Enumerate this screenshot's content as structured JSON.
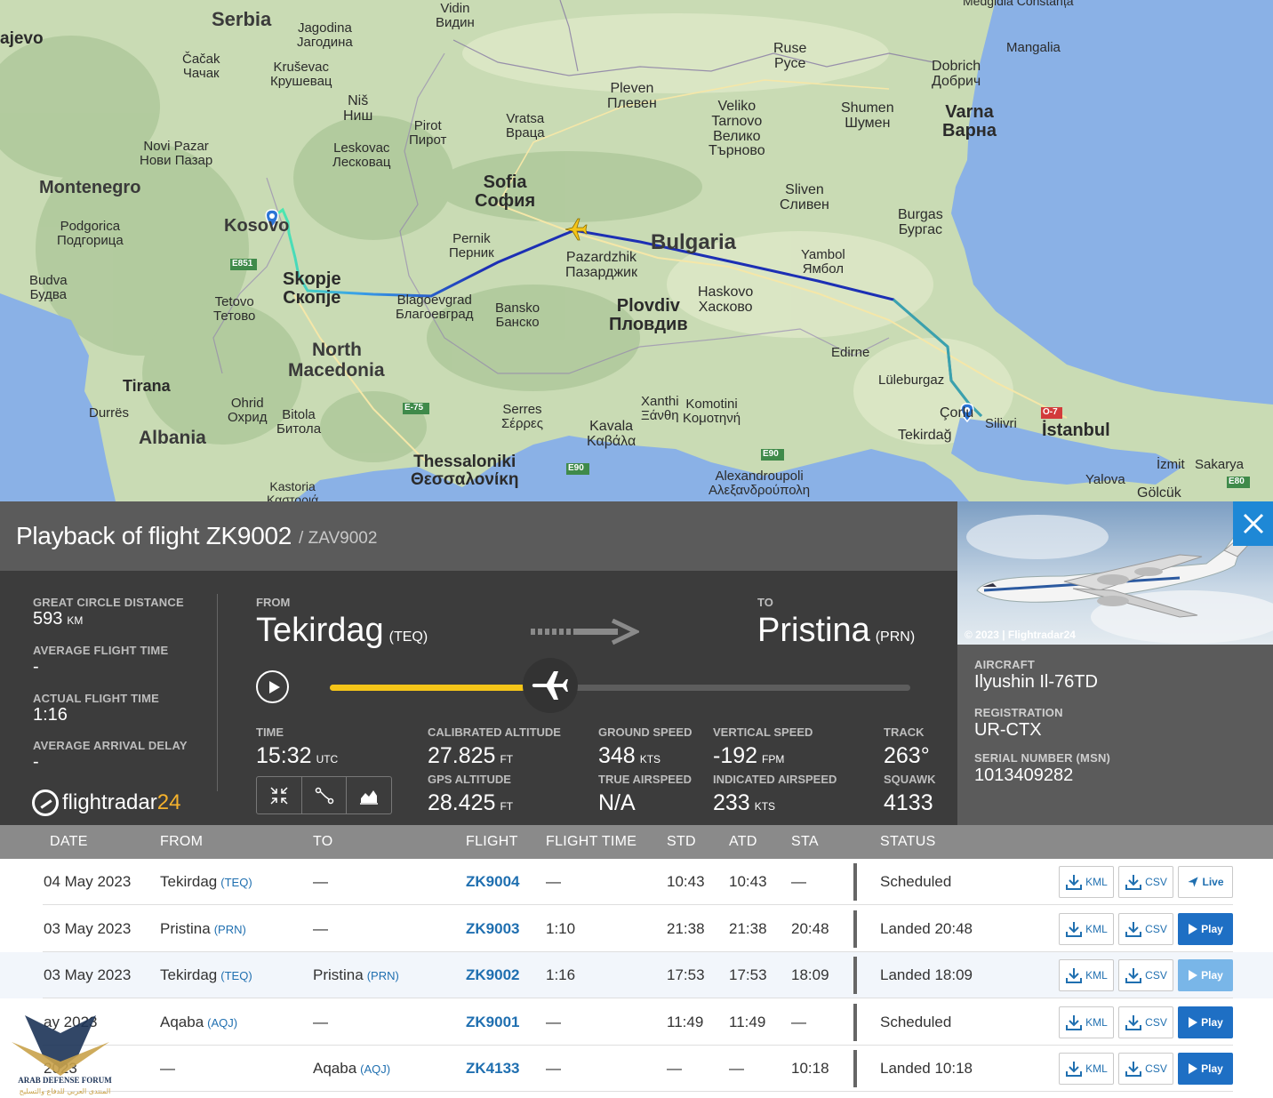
{
  "map": {
    "countries": {
      "serbia": "Serbia",
      "kosovo": "Kosovo",
      "montenegro": "Montenegro",
      "north_macedonia_1": "North",
      "north_macedonia_2": "Macedonia",
      "albania": "Albania",
      "bulgaria": "Bulgaria"
    },
    "cities": {
      "sarajevo": "ajevo",
      "vidin": [
        "Vidin",
        "Видин"
      ],
      "jagodina": [
        "Jagodina",
        "Јагодина"
      ],
      "cacak": [
        "Čačak",
        "Чачак"
      ],
      "krusevac": [
        "Kruševac",
        "Крушевац"
      ],
      "nis": [
        "Niš",
        "Ниш"
      ],
      "ruse": [
        "Ruse",
        "Русе"
      ],
      "dobrich": [
        "Dobrich",
        "Добрич"
      ],
      "mangalia": "Mangalia",
      "pleven": [
        "Pleven",
        "Плевен"
      ],
      "veliko": [
        "Veliko",
        "Tarnovo",
        "Велико",
        "Търново"
      ],
      "shumen": [
        "Shumen",
        "Шумен"
      ],
      "varna": [
        "Varna",
        "Варна"
      ],
      "pirot": [
        "Pirot",
        "Пирот"
      ],
      "vratsa": [
        "Vratsa",
        "Враца"
      ],
      "novi_pazar": [
        "Novi Pazar",
        "Нови Пазар"
      ],
      "leskovac": [
        "Leskovac",
        "Лесковац"
      ],
      "sofia": [
        "Sofia",
        "София"
      ],
      "sliven": [
        "Sliven",
        "Сливен"
      ],
      "burgas": [
        "Burgas",
        "Бургас"
      ],
      "podgorica": [
        "Podgorica",
        "Подгорица"
      ],
      "pernik": [
        "Pernik",
        "Перник"
      ],
      "pazardzhik": [
        "Pazardzhik",
        "Пазарджик"
      ],
      "yambol": [
        "Yambol",
        "Ямбол"
      ],
      "budva": [
        "Budva",
        "Будва"
      ],
      "skopje": [
        "Skopje",
        "Скопје"
      ],
      "tetovo": [
        "Tetovo",
        "Тетово"
      ],
      "blagoevgrad": [
        "Blagoevgrad",
        "Благоевград"
      ],
      "bansko": [
        "Bansko",
        "Банско"
      ],
      "haskovo": [
        "Haskovo",
        "Хасково"
      ],
      "plovdiv": [
        "Plovdiv",
        "Пловдив"
      ],
      "edirne": "Edirne",
      "luleburgaz": "Lüleburgaz",
      "tirana": "Tirana",
      "durres": "Durrës",
      "ohrid": [
        "Ohrid",
        "Охрид"
      ],
      "bitola": [
        "Bitola",
        "Битола"
      ],
      "xanthi": [
        "Xanthi",
        "Ξάνθη"
      ],
      "komotini": [
        "Komotini",
        "Κομοτηνή"
      ],
      "serres": [
        "Serres",
        "Σέρρες"
      ],
      "kavala": [
        "Kavala",
        "Καβάλα"
      ],
      "corlu": "Çorlu",
      "silivri": "Silivri",
      "istanbul": "İstanbul",
      "tekirdag": "Tekirdağ",
      "thessaloniki": [
        "Thessaloniki",
        "Θεσσαλονίκη"
      ],
      "alexandroupoli": [
        "Alexandroupoli",
        "Αλεξανδρούπολη"
      ],
      "izmit": "İzmit",
      "sakarya": "Sakarya",
      "yalova": "Yalova",
      "golcuk": "Gölcük",
      "kastoria": [
        "Kastoria",
        "Καστοριά"
      ],
      "top_right": "Medgidia Constanța"
    },
    "roads": {
      "e851": "E851",
      "e75": "E-75",
      "e90a": "E90",
      "e90b": "E90",
      "o7": "O-7",
      "e80": "E80"
    },
    "colors": {
      "sea": "#8ab1e6",
      "land": "#c9dbb4",
      "route": "#1c2fb4",
      "route_start": "#4ef0a8"
    }
  },
  "title": {
    "main": "Playback of flight ZK9002",
    "callsign": "/ ZAV9002"
  },
  "stats": {
    "great_circle_label": "GREAT CIRCLE DISTANCE",
    "great_circle_value": "593",
    "great_circle_unit": "KM",
    "avg_flight_label": "AVERAGE FLIGHT TIME",
    "avg_flight_value": "-",
    "actual_flight_label": "ACTUAL FLIGHT TIME",
    "actual_flight_value": "1:16",
    "avg_delay_label": "AVERAGE ARRIVAL DELAY",
    "avg_delay_value": "-"
  },
  "logo": {
    "text": "flightradar",
    "num": "24"
  },
  "route": {
    "from_label": "FROM",
    "from_city": "Tekirdag",
    "from_code": "(TEQ)",
    "to_label": "TO",
    "to_city": "Pristina",
    "to_code": "(PRN)"
  },
  "playback": {
    "progress": 0.38
  },
  "flight_data": {
    "time_label": "TIME",
    "time_value": "15:32",
    "time_unit": "UTC",
    "cal_alt_label": "CALIBRATED ALTITUDE",
    "cal_alt_value": "27.825",
    "cal_alt_unit": "FT",
    "gps_alt_label": "GPS ALTITUDE",
    "gps_alt_value": "28.425",
    "gps_alt_unit": "FT",
    "gs_label": "GROUND SPEED",
    "gs_value": "348",
    "gs_unit": "KTS",
    "tas_label": "TRUE AIRSPEED",
    "tas_value": "N/A",
    "vs_label": "VERTICAL SPEED",
    "vs_value": "-192",
    "vs_unit": "FPM",
    "ias_label": "INDICATED AIRSPEED",
    "ias_value": "233",
    "ias_unit": "KTS",
    "track_label": "TRACK",
    "track_value": "263°",
    "squawk_label": "SQUAWK",
    "squawk_value": "4133"
  },
  "aircraft": {
    "photo_credit": "© 2023 | Flightradar24",
    "aircraft_label": "AIRCRAFT",
    "aircraft_value": "Ilyushin Il-76TD",
    "reg_label": "REGISTRATION",
    "reg_value": "UR-CTX",
    "msn_label": "SERIAL NUMBER (MSN)",
    "msn_value": "1013409282"
  },
  "table": {
    "headers": {
      "date": "DATE",
      "from": "FROM",
      "to": "TO",
      "flight": "FLIGHT",
      "flight_time": "FLIGHT TIME",
      "std": "STD",
      "atd": "ATD",
      "sta": "STA",
      "status": "STATUS"
    },
    "kml": "KML",
    "csv": "CSV",
    "live": "Live",
    "play": "Play",
    "rows": [
      {
        "date": "04 May 2023",
        "from": "Tekirdag",
        "from_code": "(TEQ)",
        "to": "—",
        "to_code": "",
        "flight": "ZK9004",
        "flight_time": "—",
        "std": "10:43",
        "atd": "10:43",
        "sta": "—",
        "status": "Scheduled"
      },
      {
        "date": "03 May 2023",
        "from": "Pristina",
        "from_code": "(PRN)",
        "to": "—",
        "to_code": "",
        "flight": "ZK9003",
        "flight_time": "1:10",
        "std": "21:38",
        "atd": "21:38",
        "sta": "20:48",
        "status": "Landed 20:48"
      },
      {
        "date": "03 May 2023",
        "from": "Tekirdag",
        "from_code": "(TEQ)",
        "to": "Pristina",
        "to_code": "(PRN)",
        "flight": "ZK9002",
        "flight_time": "1:16",
        "std": "17:53",
        "atd": "17:53",
        "sta": "18:09",
        "status": "Landed 18:09"
      },
      {
        "date": "ay 2023",
        "from": "Aqaba",
        "from_code": "(AQJ)",
        "to": "—",
        "to_code": "",
        "flight": "ZK9001",
        "flight_time": "—",
        "std": "11:49",
        "atd": "11:49",
        "sta": "—",
        "status": "Scheduled"
      },
      {
        "date": "2023",
        "from": "—",
        "from_code": "",
        "to": "Aqaba",
        "to_code": "(AQJ)",
        "flight": "ZK4133",
        "flight_time": "—",
        "std": "—",
        "atd": "—",
        "sta": "10:18",
        "status": "Landed 10:18"
      }
    ]
  },
  "watermark": {
    "line1": "ARAB DEFENSE FORUM",
    "line2": "المنتدى العربي للدفاع والتسليح"
  }
}
